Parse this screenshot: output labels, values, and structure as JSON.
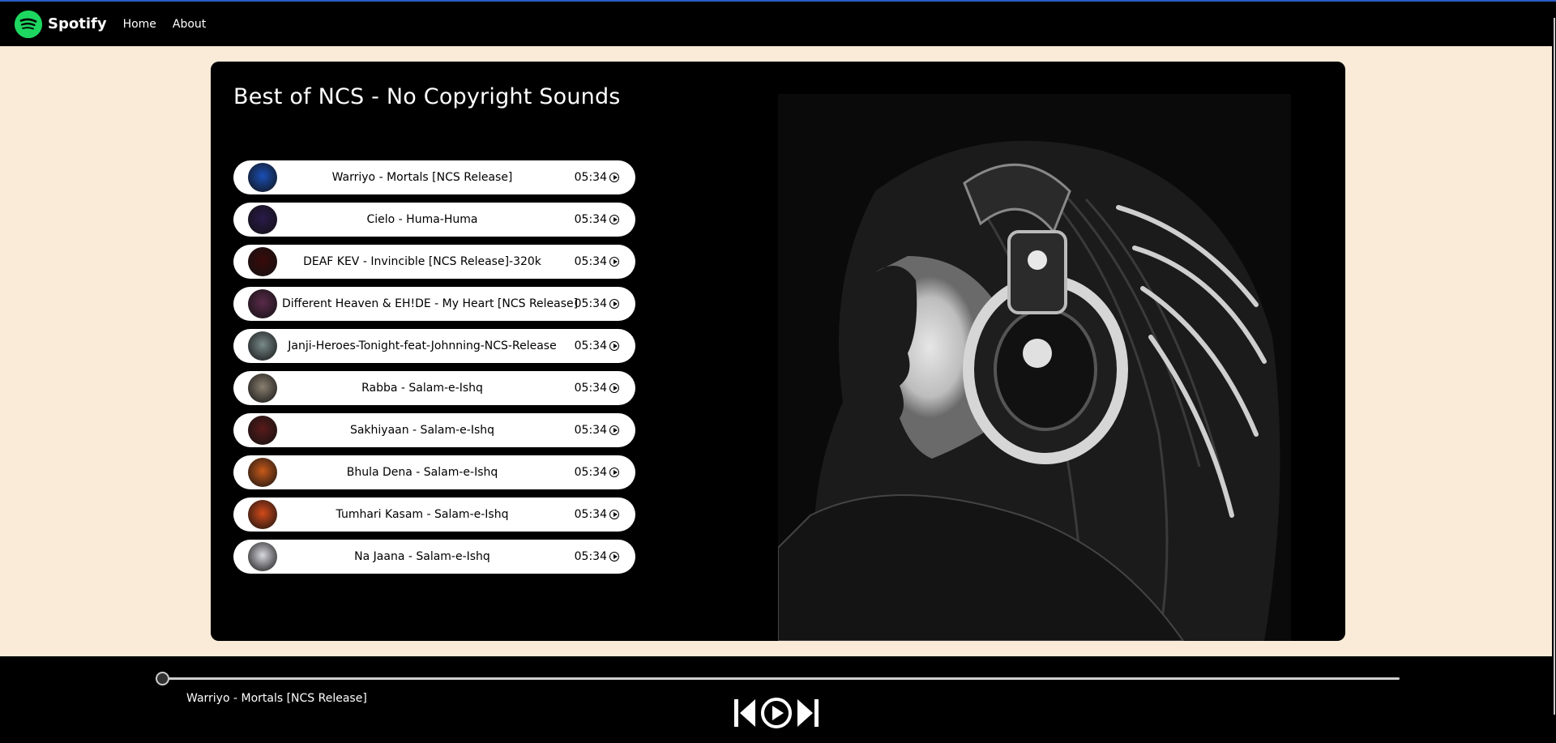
{
  "nav": {
    "brand": "Spotify",
    "links": [
      "Home",
      "About"
    ]
  },
  "playlist": {
    "title": "Best of NCS - No Copyright Sounds",
    "songs": [
      {
        "name": "Warriyo - Mortals [NCS Release]",
        "duration": "05:34",
        "cover_color": "#1a4fb5"
      },
      {
        "name": "Cielo - Huma-Huma",
        "duration": "05:34",
        "cover_color": "#2a1a4a"
      },
      {
        "name": "DEAF KEV - Invincible [NCS Release]-320k",
        "duration": "05:34",
        "cover_color": "#3a0a0a"
      },
      {
        "name": "Different Heaven & EH!DE - My Heart [NCS Release]",
        "duration": "05:34",
        "cover_color": "#5a2a4a"
      },
      {
        "name": "Janji-Heroes-Tonight-feat-Johnning-NCS-Release",
        "duration": "05:34",
        "cover_color": "#7a8a8a"
      },
      {
        "name": "Rabba - Salam-e-Ishq",
        "duration": "05:34",
        "cover_color": "#8a8070"
      },
      {
        "name": "Sakhiyaan - Salam-e-Ishq",
        "duration": "05:34",
        "cover_color": "#5a1a1a"
      },
      {
        "name": "Bhula Dena - Salam-e-Ishq",
        "duration": "05:34",
        "cover_color": "#c85a1a"
      },
      {
        "name": "Tumhari Kasam - Salam-e-Ishq",
        "duration": "05:34",
        "cover_color": "#d24a1a"
      },
      {
        "name": "Na Jaana - Salam-e-Ishq",
        "duration": "05:34",
        "cover_color": "#d8d8e0"
      }
    ]
  },
  "player": {
    "now_playing": "Warriyo - Mortals [NCS Release]",
    "progress": 0
  },
  "colors": {
    "accent": "#1ed760",
    "page_bg": "#f9ebd8",
    "panel_bg": "#000000"
  },
  "icons": {
    "brand": "spotify-logo",
    "song_play": "play-circle-icon",
    "prev": "skip-back-icon",
    "play": "play-circle-icon",
    "next": "skip-forward-icon"
  }
}
